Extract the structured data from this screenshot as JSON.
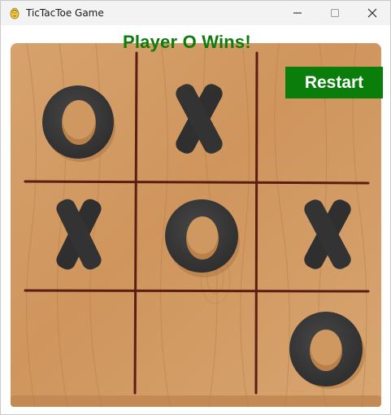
{
  "window": {
    "title": "TicTacToe Game",
    "controls": [
      "minimize",
      "maximize",
      "close"
    ]
  },
  "game": {
    "status_text": "Player O Wins!",
    "restart_label": "Restart",
    "board": [
      [
        "O",
        "X",
        ""
      ],
      [
        "X",
        "O",
        "X"
      ],
      [
        "",
        "",
        "O"
      ]
    ]
  },
  "colors": {
    "status": "#0b7d0b",
    "restart_bg": "#0b7d0b",
    "restart_text": "#ffffff",
    "board_wood": "#d29a63",
    "piece": "#3a3a3a",
    "grid_line": "#5a1e12"
  },
  "icons": {
    "app": "pygame-snake-icon",
    "minimize": "minimize-icon",
    "maximize": "maximize-icon",
    "close": "close-icon"
  }
}
